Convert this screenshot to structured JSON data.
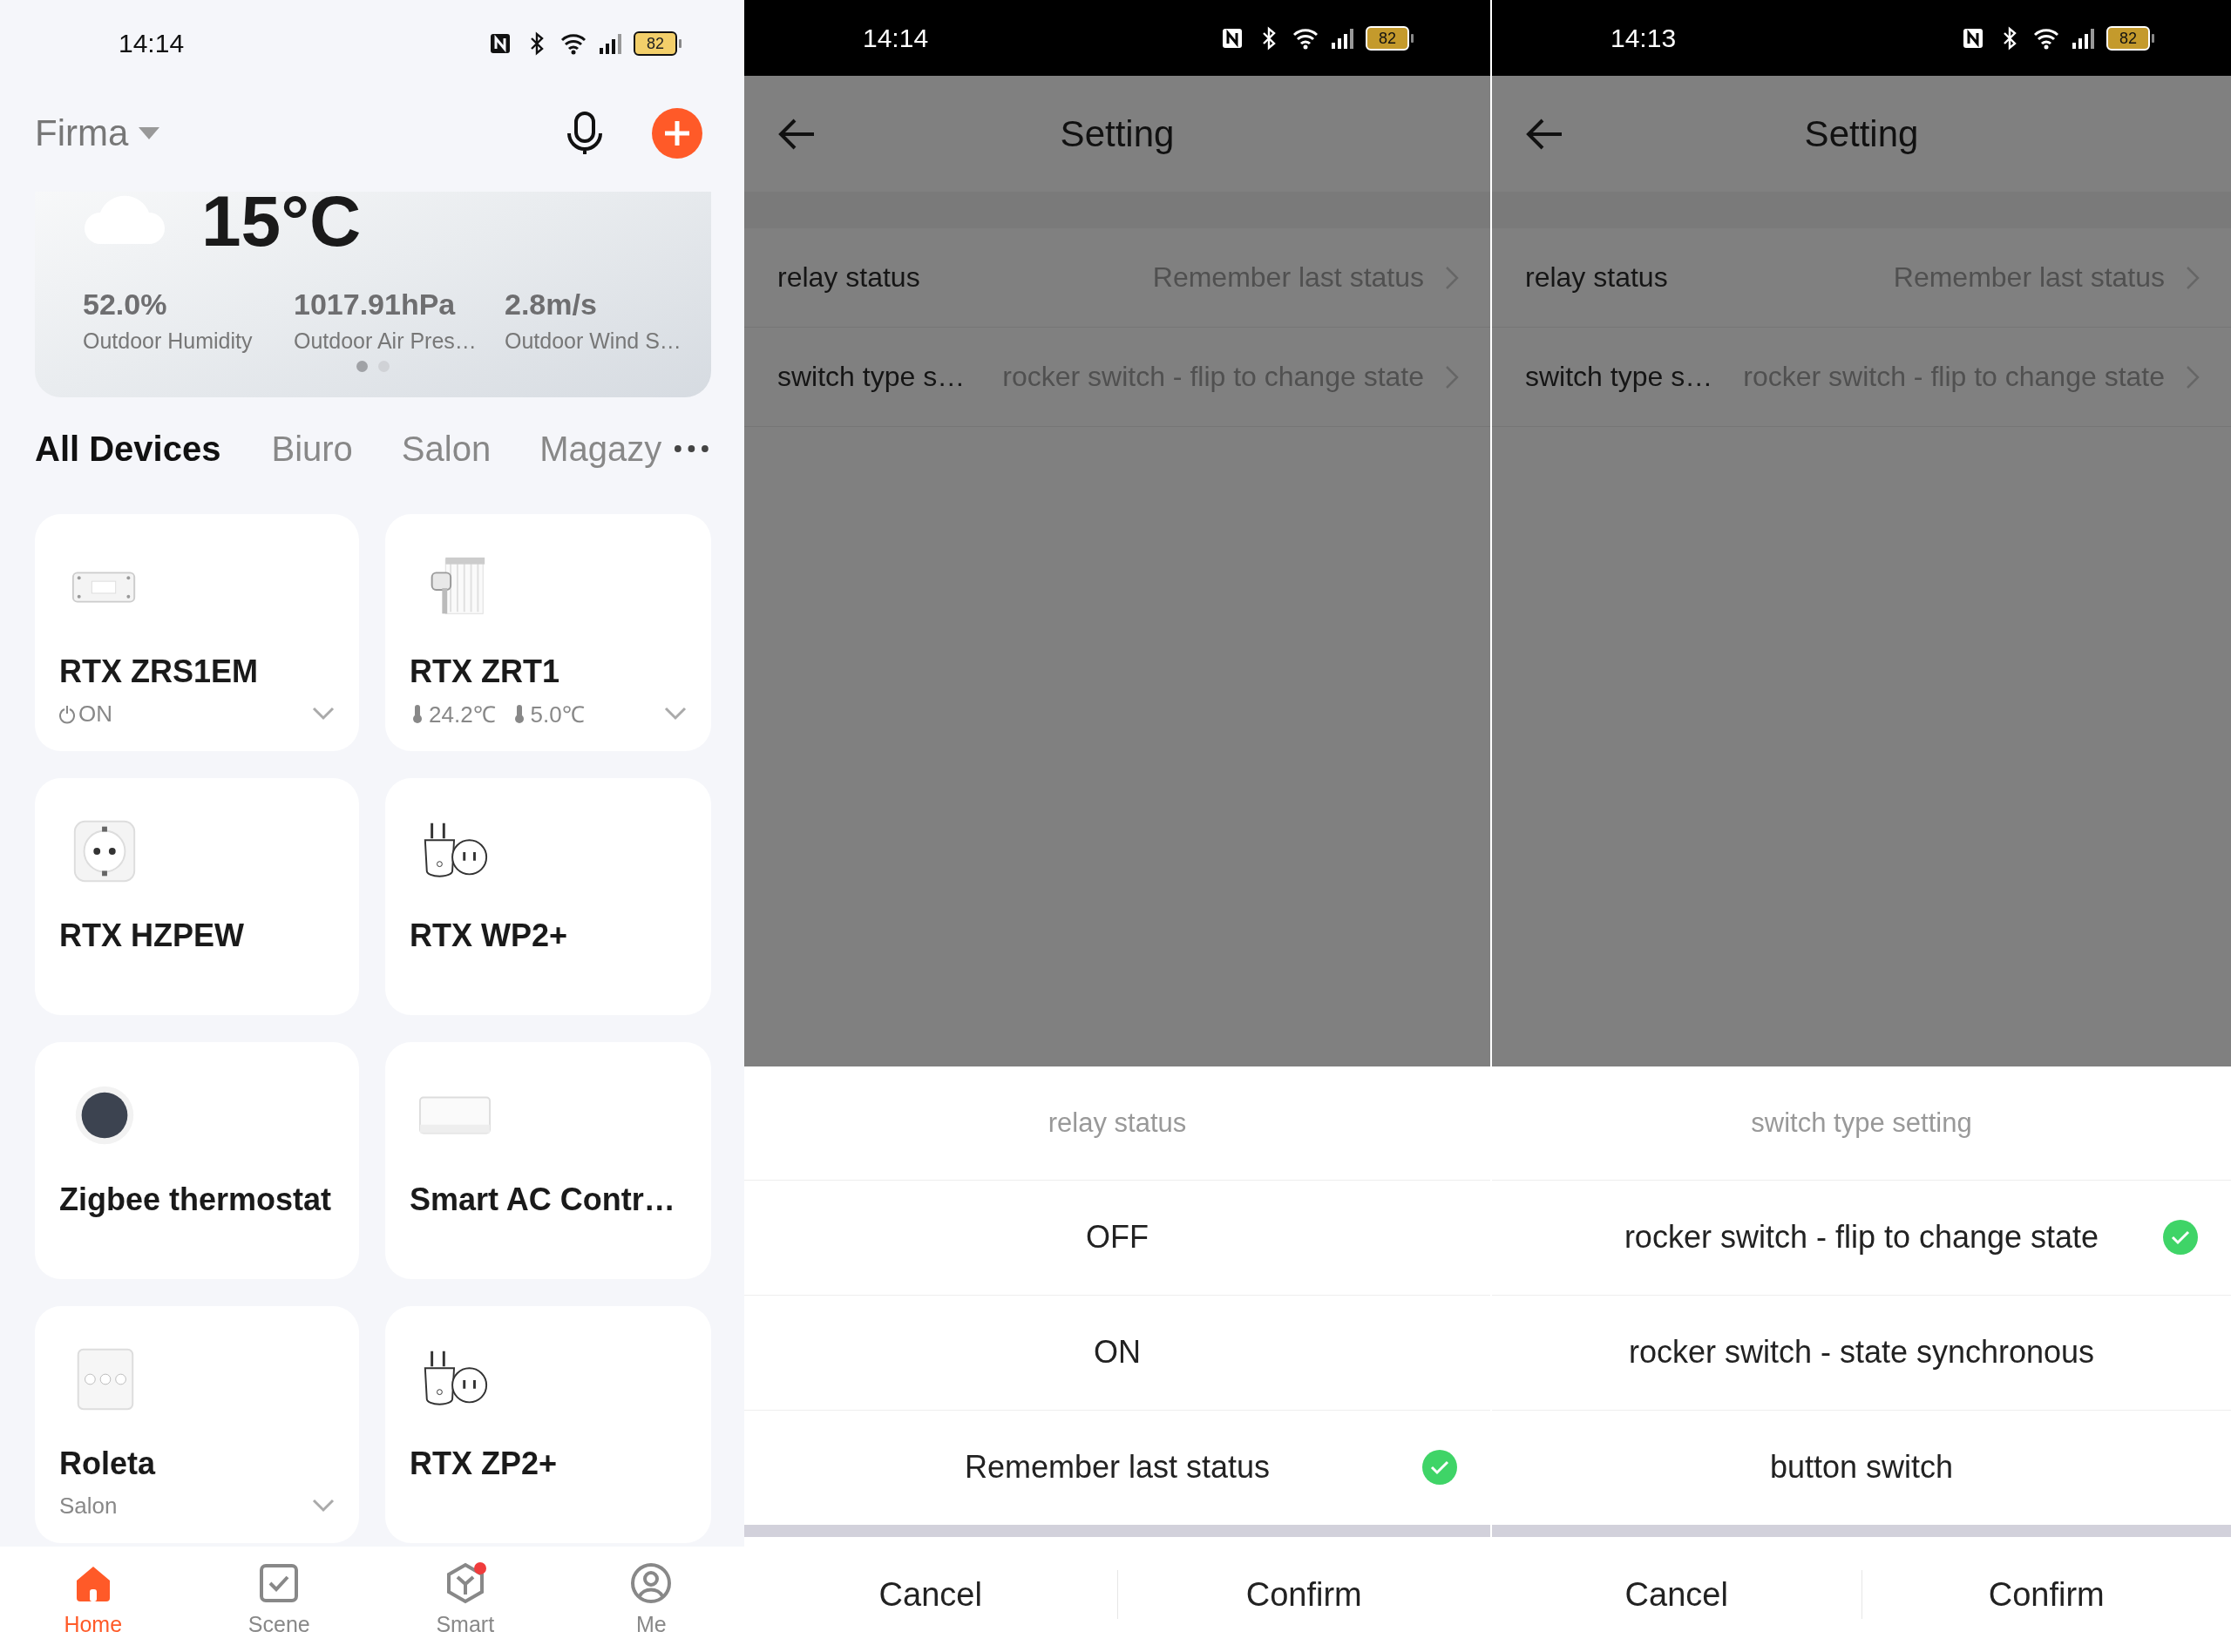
{
  "home": {
    "status_bar": {
      "time": "14:14",
      "battery": "82"
    },
    "home_name": "Firma",
    "weather": {
      "temperature": "15°C",
      "stats": [
        {
          "value": "52.0%",
          "label": "Outdoor Humidity"
        },
        {
          "value": "1017.91hPa",
          "label": "Outdoor Air Pres…"
        },
        {
          "value": "2.8m/s",
          "label": "Outdoor Wind S…"
        }
      ],
      "pages": [
        {
          "selected": true
        },
        {
          "selected": false
        }
      ]
    },
    "tabs": [
      {
        "label": "All Devices",
        "selected": true
      },
      {
        "label": "Biuro",
        "selected": false
      },
      {
        "label": "Salon",
        "selected": false
      },
      {
        "label": "Magazy",
        "selected": false
      }
    ],
    "devices": [
      {
        "name": "RTX ZRS1EM",
        "kind": "switch-module",
        "status": [
          {
            "kind": "power",
            "text": "ON"
          }
        ],
        "expandable": true
      },
      {
        "name": "RTX ZRT1",
        "kind": "radiator-valve",
        "status": [
          {
            "kind": "temperature",
            "text": "24.2℃"
          },
          {
            "kind": "temperature",
            "text": "5.0℃"
          }
        ],
        "expandable": true
      },
      {
        "name": "RTX HZPEW",
        "kind": "wall-socket",
        "expandable": false
      },
      {
        "name": "RTX WP2+",
        "kind": "plug-adapter",
        "expandable": false
      },
      {
        "name": "Zigbee thermostat",
        "kind": "round-thermostat",
        "expandable": false
      },
      {
        "name": "Smart AC Contr…",
        "kind": "ir-controller",
        "expandable": false
      },
      {
        "name": "Roleta",
        "kind": "blind-switch",
        "status": [
          {
            "kind": "text",
            "text": "Salon"
          }
        ],
        "expandable": true
      },
      {
        "name": "RTX ZP2+",
        "kind": "plug-adapter",
        "expandable": false
      }
    ],
    "nav": [
      {
        "label": "Home",
        "kind": "home",
        "selected": true,
        "badge": false
      },
      {
        "label": "Scene",
        "kind": "scene",
        "selected": false,
        "badge": false
      },
      {
        "label": "Smart",
        "kind": "smart",
        "selected": false,
        "badge": true
      },
      {
        "label": "Me",
        "kind": "me",
        "selected": false,
        "badge": false
      }
    ]
  },
  "settings_screens": [
    {
      "status_bar": {
        "time": "14:14",
        "battery": "82"
      },
      "title": "Setting",
      "rows": [
        {
          "label": "relay status",
          "value": "Remember last status"
        },
        {
          "label": "switch type s…",
          "value": "rocker switch - flip to change state"
        }
      ],
      "sheet": {
        "title": "relay status",
        "options": [
          {
            "label": "OFF",
            "selected": false
          },
          {
            "label": "ON",
            "selected": false
          },
          {
            "label": "Remember last status",
            "selected": true
          }
        ],
        "buttons": [
          "Cancel",
          "Confirm"
        ]
      }
    },
    {
      "status_bar": {
        "time": "14:13",
        "battery": "82"
      },
      "title": "Setting",
      "rows": [
        {
          "label": "relay status",
          "value": "Remember last status"
        },
        {
          "label": "switch type s…",
          "value": "rocker switch - flip to change state"
        }
      ],
      "sheet": {
        "title": "switch type setting",
        "options": [
          {
            "label": "rocker switch - flip to change state",
            "selected": true
          },
          {
            "label": "rocker switch - state synchronous",
            "selected": false
          },
          {
            "label": "button switch",
            "selected": false
          }
        ],
        "buttons": [
          "Cancel",
          "Confirm"
        ]
      }
    }
  ]
}
